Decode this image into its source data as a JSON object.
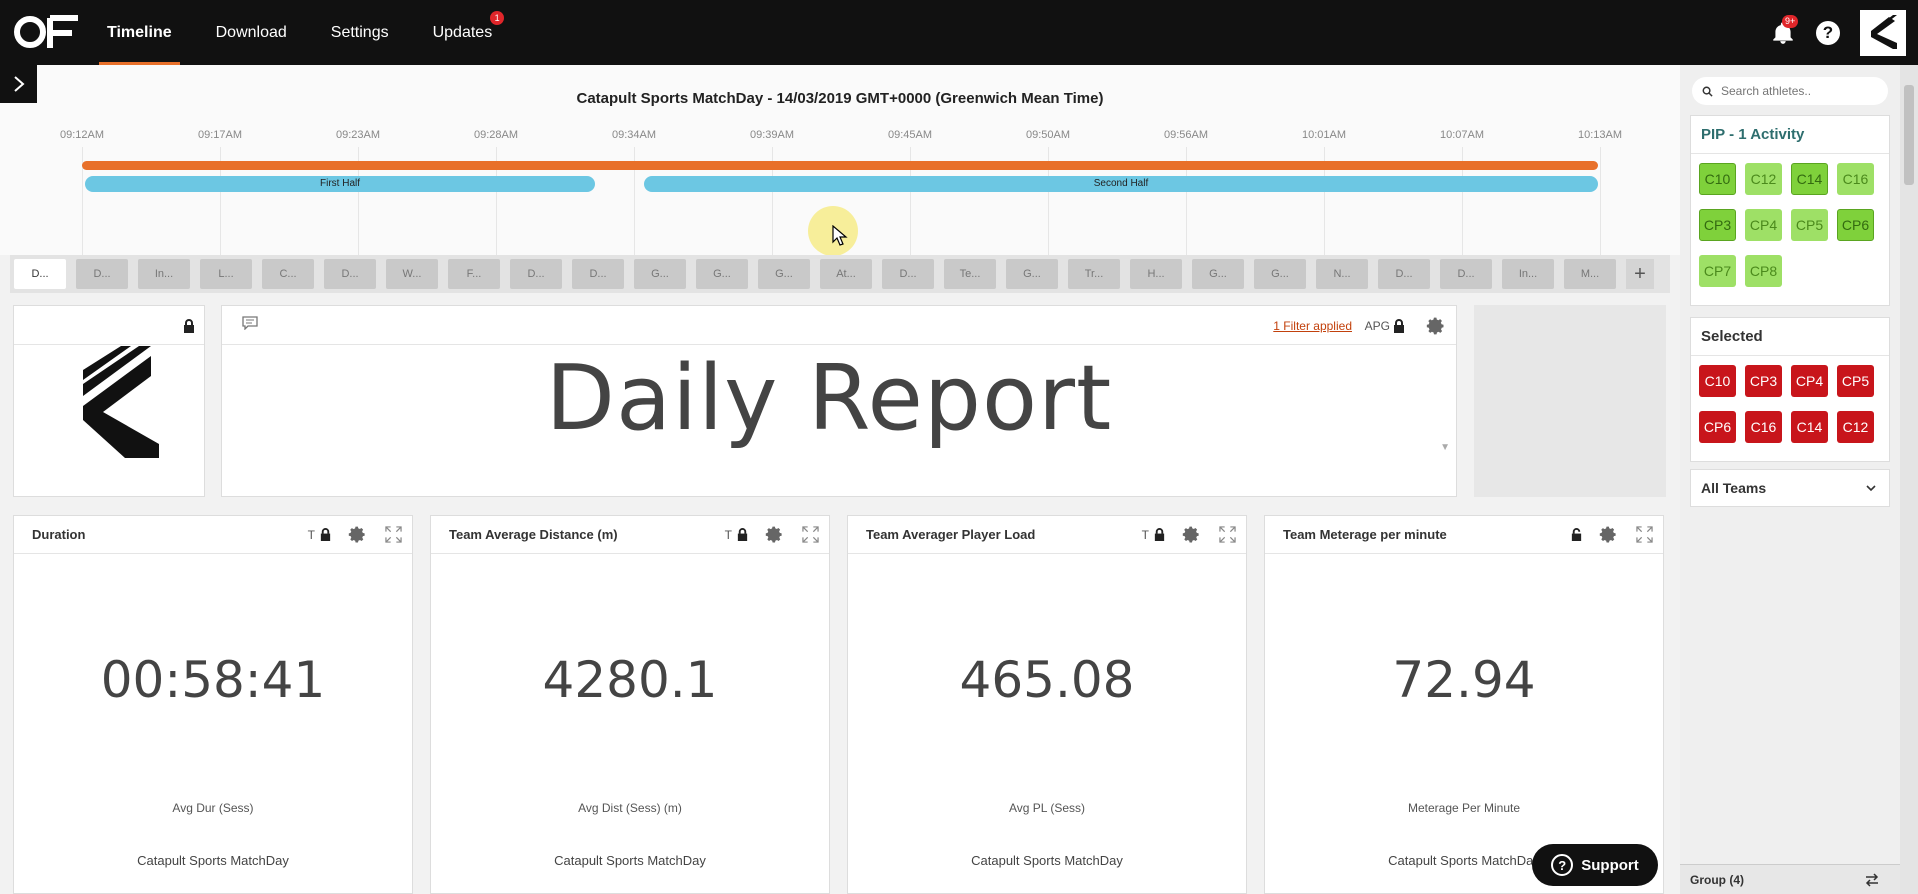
{
  "nav": {
    "items": [
      {
        "label": "Timeline",
        "active": true
      },
      {
        "label": "Download",
        "active": false
      },
      {
        "label": "Settings",
        "active": false
      },
      {
        "label": "Updates",
        "active": false,
        "badge": "1"
      }
    ],
    "notifications_badge": "9+",
    "help_label": "?"
  },
  "timeline": {
    "title": "Catapult Sports MatchDay - 14/03/2019 GMT+0000 (Greenwich Mean Time)",
    "ticks": [
      "09:12AM",
      "09:17AM",
      "09:23AM",
      "09:28AM",
      "09:34AM",
      "09:39AM",
      "09:45AM",
      "09:50AM",
      "09:56AM",
      "10:01AM",
      "10:07AM",
      "10:13AM"
    ],
    "periods": [
      {
        "label": "First Half"
      },
      {
        "label": "Second Half"
      }
    ]
  },
  "tabs": [
    "D...",
    "D...",
    "In...",
    "L...",
    "C...",
    "D...",
    "W...",
    "F...",
    "D...",
    "D...",
    "G...",
    "G...",
    "G...",
    "At...",
    "D...",
    "Te...",
    "G...",
    "Tr...",
    "H...",
    "G...",
    "G...",
    "N...",
    "D...",
    "D...",
    "In...",
    "M..."
  ],
  "tab_add_label": "+",
  "report": {
    "title": "Daily Report",
    "filter_label": "1 Filter applied",
    "apg_label": "APG"
  },
  "cards": [
    {
      "title": "Duration",
      "t_label": "T",
      "value": "00:58:41",
      "metric": "Avg Dur (Sess)",
      "source": "Catapult Sports MatchDay",
      "locked": true
    },
    {
      "title": "Team Average Distance (m)",
      "t_label": "T",
      "value": "4280.1",
      "metric": "Avg Dist (Sess) (m)",
      "source": "Catapult Sports MatchDay",
      "locked": true
    },
    {
      "title": "Team Averager Player Load",
      "t_label": "T",
      "value": "465.08",
      "metric": "Avg PL (Sess)",
      "source": "Catapult Sports MatchDay",
      "locked": true
    },
    {
      "title": "Team Meterage per minute",
      "t_label": "",
      "value": "72.94",
      "metric": "Meterage Per Minute",
      "source": "Catapult Sports MatchDay",
      "locked": false
    }
  ],
  "sidebar": {
    "search_placeholder": "Search athletes..",
    "pip_title": "PIP - 1 Activity",
    "pip_chips": [
      {
        "label": "C10",
        "style": "green"
      },
      {
        "label": "C12",
        "style": "lime"
      },
      {
        "label": "C14",
        "style": "green"
      },
      {
        "label": "C16",
        "style": "lime"
      },
      {
        "label": "CP3",
        "style": "green"
      },
      {
        "label": "CP4",
        "style": "lime"
      },
      {
        "label": "CP5",
        "style": "lime"
      },
      {
        "label": "CP6",
        "style": "green"
      },
      {
        "label": "CP7",
        "style": "lime"
      },
      {
        "label": "CP8",
        "style": "lime"
      }
    ],
    "selected_title": "Selected",
    "selected_chips": [
      "C10",
      "CP3",
      "CP4",
      "CP5",
      "CP6",
      "C16",
      "C14",
      "C12"
    ],
    "teams_label": "All Teams",
    "group_label": "Group (4)"
  },
  "support_label": "Support",
  "colors": {
    "accent": "#e8702a",
    "period": "#6cc7e3",
    "selected": "#c8151b",
    "pip": "#7fd13b"
  }
}
